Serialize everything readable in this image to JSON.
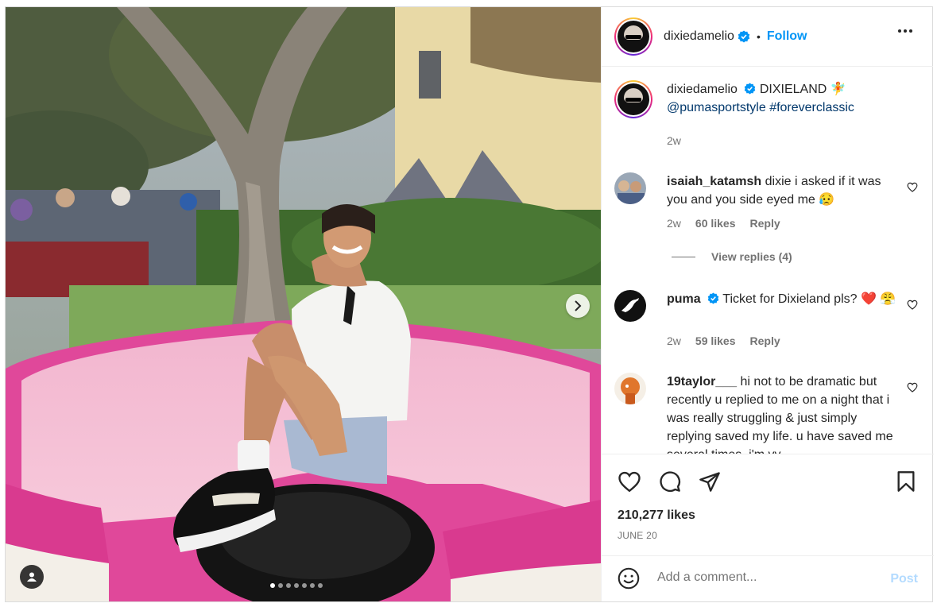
{
  "post": {
    "author": "dixiedamelio",
    "follow_label": "Follow",
    "separator": "•",
    "caption": {
      "username": "dixiedamelio",
      "text": "DIXIELAND",
      "emoji": "🧚",
      "mention": "@pumasportstyle",
      "hashtag": "#foreverclassic",
      "time": "2w"
    },
    "likes": "210,277 likes",
    "date": "JUNE 20",
    "carousel": {
      "total": 7,
      "active": 1
    }
  },
  "comments": [
    {
      "username": "isaiah_katamsh",
      "text": "dixie i asked if it was you and you side eyed me 😥",
      "time": "2w",
      "likes": "60 likes",
      "reply": "Reply",
      "view_replies": "View replies (4)"
    },
    {
      "username": "puma",
      "verified": true,
      "text": "Ticket for Dixieland pls? ❤️ 😤",
      "time": "2w",
      "likes": "59 likes",
      "reply": "Reply"
    },
    {
      "username": "19taylor___",
      "text": "hi not to be dramatic but recently u replied to me on a night that i was really struggling & just simply replying saved my life. u have saved me several times, i'm vv"
    }
  ],
  "composer": {
    "placeholder": "Add a comment...",
    "post_label": "Post"
  },
  "icons": {
    "verified": "verified-badge-icon",
    "more": "more-options-icon",
    "heart": "heart-icon",
    "comment": "comment-icon",
    "share": "share-icon",
    "bookmark": "bookmark-icon",
    "emoji": "emoji-icon",
    "next": "chevron-right-icon",
    "user_tag": "user-tag-icon"
  },
  "colors": {
    "accent": "#0095f6",
    "link": "#00376b",
    "muted": "#737373",
    "post_disabled": "#b3dbff"
  }
}
